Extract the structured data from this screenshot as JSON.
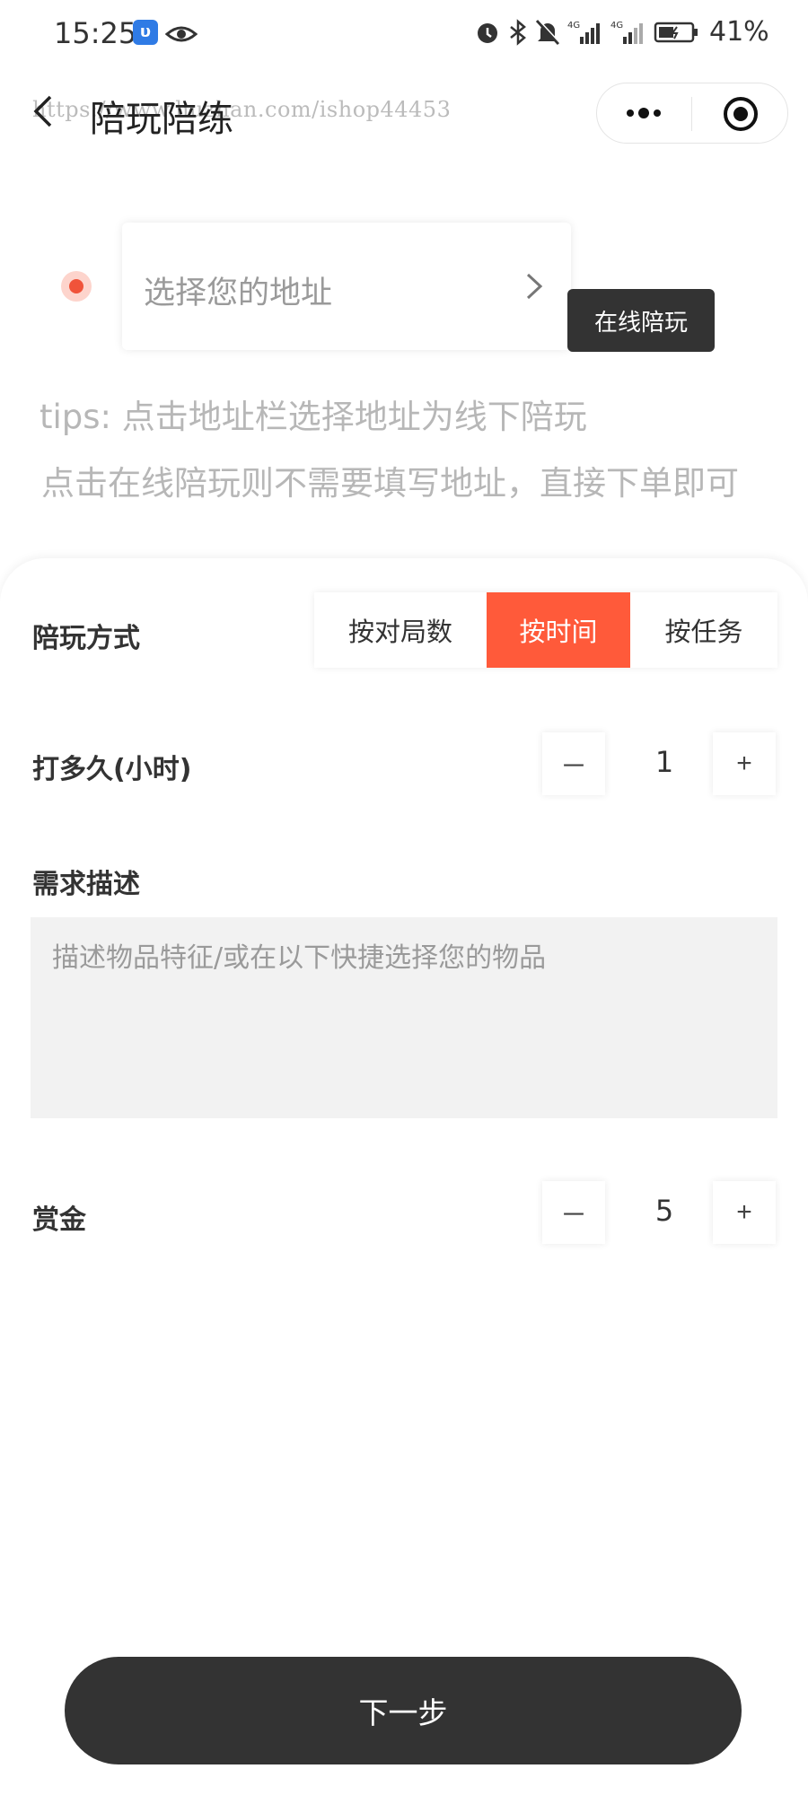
{
  "status_bar": {
    "time": "15:25",
    "battery": "41%"
  },
  "nav": {
    "title": "陪玩陪练",
    "watermark": "https://www.huzhan.com/ishop44453"
  },
  "address": {
    "placeholder": "选择您的地址",
    "online_button": "在线陪玩"
  },
  "tips": {
    "line1": "tips: 点击地址栏选择地址为线下陪玩",
    "line2": "点击在线陪玩则不需要填写地址，直接下单即可"
  },
  "form": {
    "mode_label": "陪玩方式",
    "mode_options": [
      "按对局数",
      "按时间",
      "按任务"
    ],
    "mode_selected": "按时间",
    "hours_label": "打多久(小时)",
    "hours_value": "1",
    "desc_label": "需求描述",
    "desc_placeholder": "描述物品特征/或在以下快捷选择您的物品",
    "bounty_label": "赏金",
    "bounty_value": "5",
    "minus": "－",
    "plus": "+"
  },
  "next_button": "下一步",
  "colors": {
    "accent": "#ff5a3a",
    "dark": "#333333",
    "tip": "#b7b7b7"
  }
}
